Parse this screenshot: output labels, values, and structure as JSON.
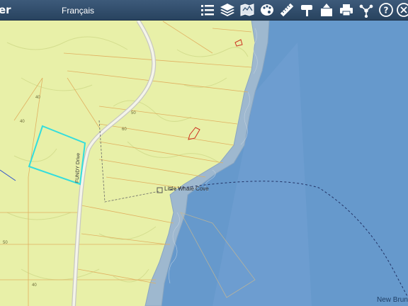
{
  "header": {
    "app_title": "er",
    "language_link": "Français"
  },
  "toolbar": {
    "tools": [
      {
        "name": "layer-list-icon"
      },
      {
        "name": "layers-icon"
      },
      {
        "name": "basemap-icon"
      },
      {
        "name": "palette-icon"
      },
      {
        "name": "measure-icon"
      },
      {
        "name": "draw-icon"
      },
      {
        "name": "export-icon"
      },
      {
        "name": "print-icon"
      },
      {
        "name": "share-icon"
      },
      {
        "name": "help-icon"
      },
      {
        "name": "close-icon"
      }
    ]
  },
  "map": {
    "place_label": "Little Whale Cove",
    "road_label": "FUNDY Drive",
    "contour_labels": [
      "40",
      "60",
      "50",
      "40",
      "50",
      "40"
    ],
    "copyright": "New Brun",
    "colors": {
      "land": "#e8f0a8",
      "water": "#6699cc",
      "selection": "#33dddd",
      "parcel_line": "#e0b060"
    }
  }
}
